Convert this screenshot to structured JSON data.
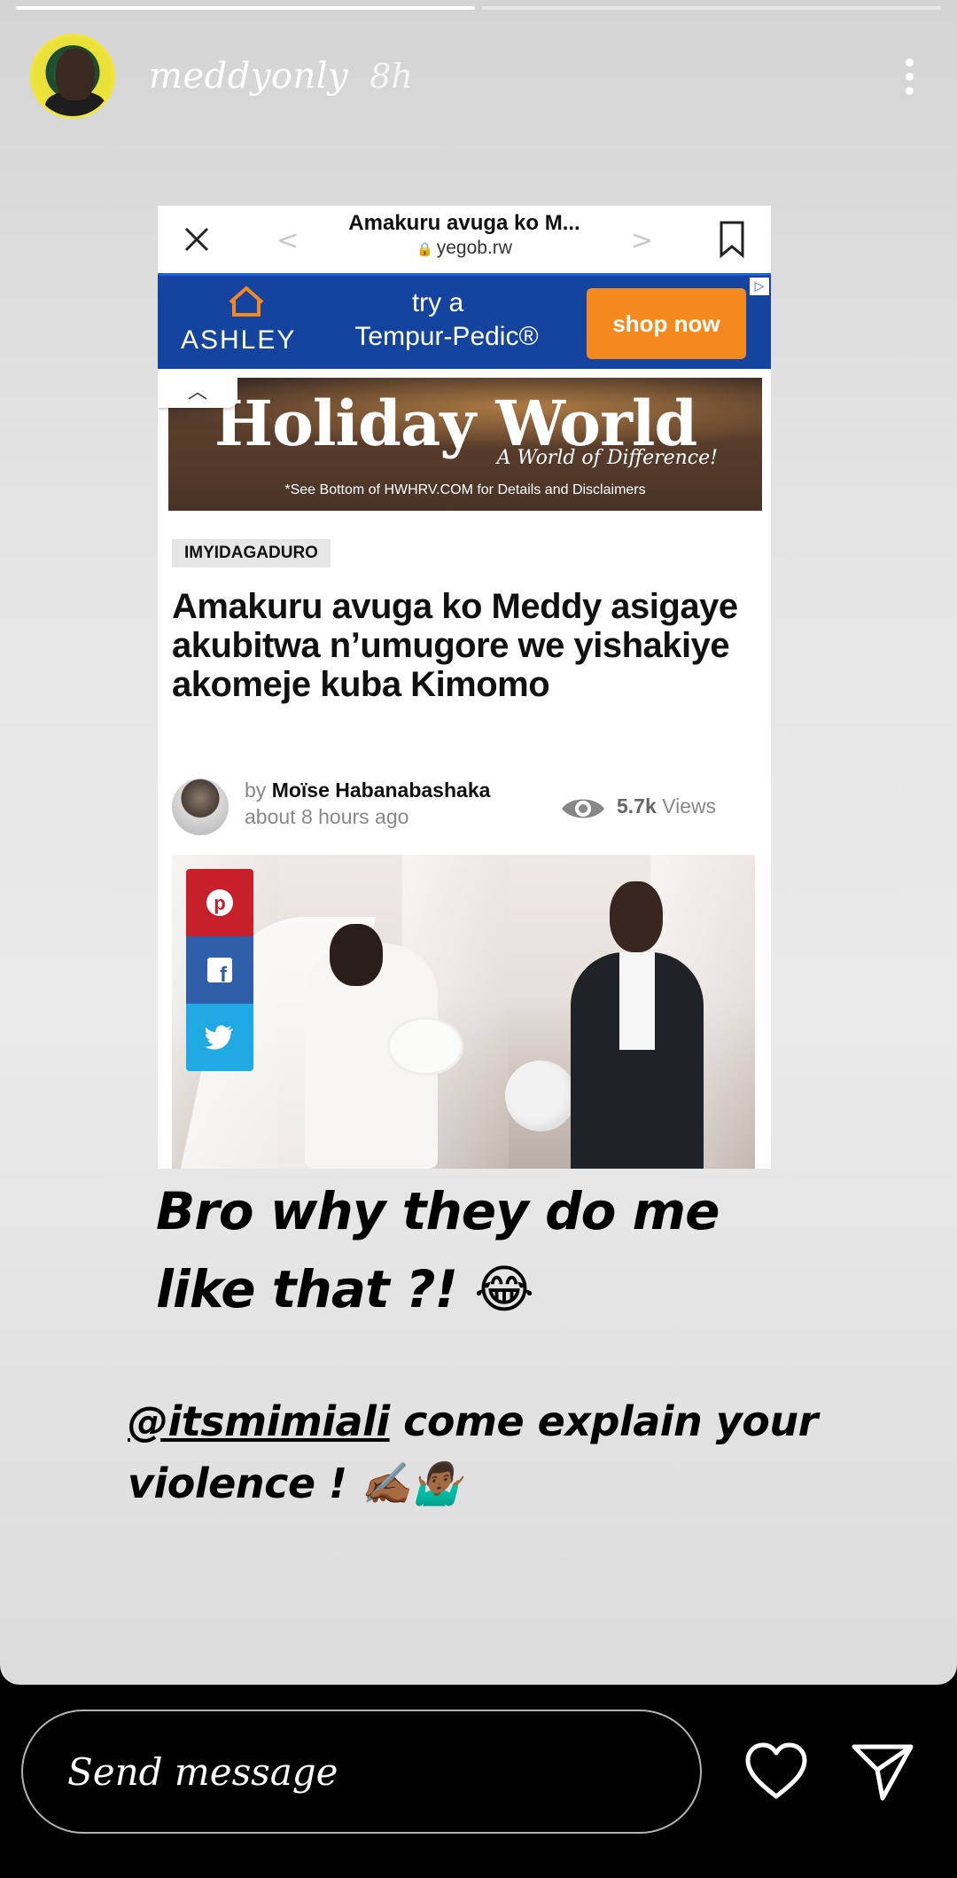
{
  "story": {
    "progress": [
      1.0,
      0.0
    ],
    "username": "meddyonly",
    "time": "8h"
  },
  "article": {
    "browser_title": "Amakuru avuga ko M...",
    "browser_host": "yegob.rw",
    "ad_top": {
      "brand": "ASHLEY",
      "line1": "try a",
      "line2": "Tempur-Pedic®",
      "cta": "shop now"
    },
    "ad_banner": {
      "title": "Holiday World",
      "tagline": "A World of Difference!",
      "disclaimer": "*See Bottom of HWHRV.COM for Details and Disclaimers"
    },
    "category": "IMYIDAGADURO",
    "headline": "Amakuru avuga ko Meddy asigaye akubitwa n’umugore we yishakiye akomeje kuba Kimomo",
    "by_prefix": "by",
    "author": "Moïse Habanabashaka",
    "time_ago": "about 8 hours ago",
    "views_count": "5.7k",
    "views_label": "Views"
  },
  "captions": {
    "line1": "Bro why they do me like that ?! 😂",
    "mention": "@itsmimiali",
    "line2_rest": " come explain your violence ! ✍🏾🤷🏾‍♂️"
  },
  "reply": {
    "placeholder": "Send message"
  }
}
